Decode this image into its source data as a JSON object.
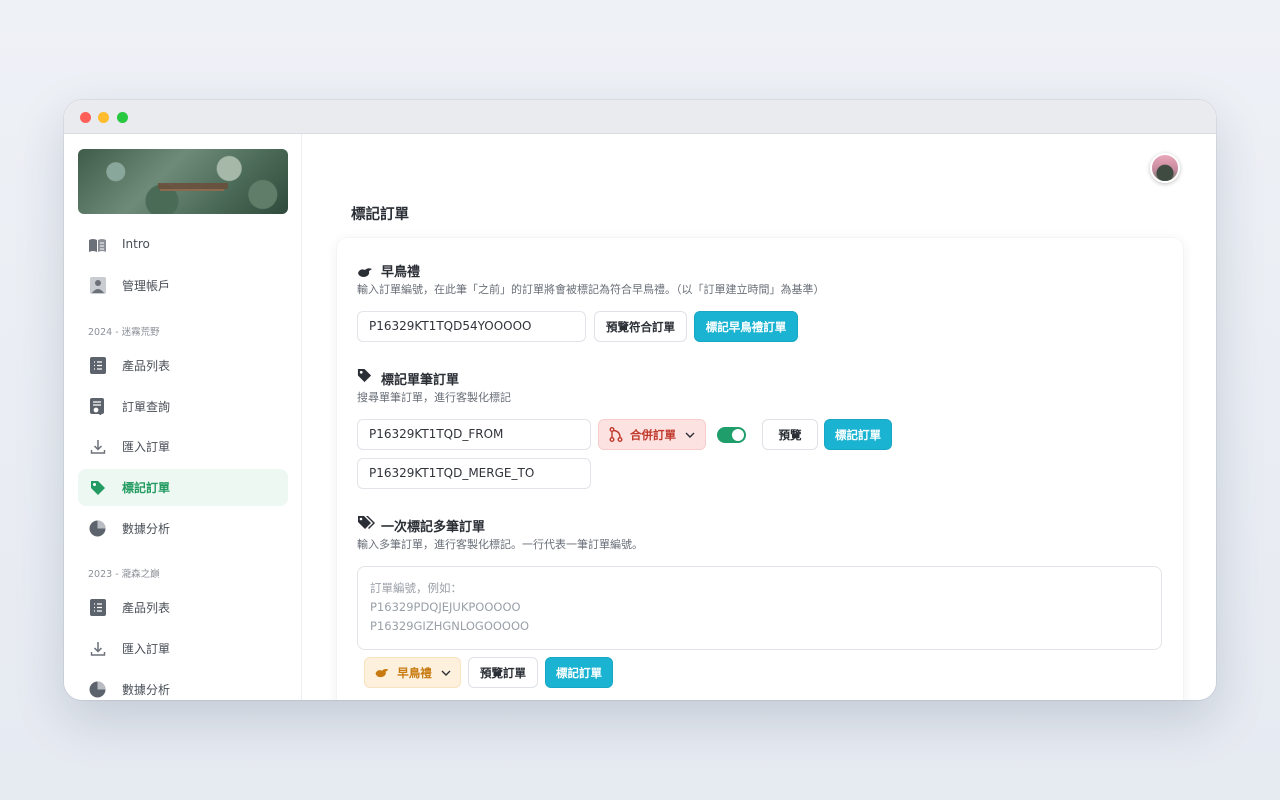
{
  "sidebar": {
    "items_top": [
      {
        "label": "Intro"
      },
      {
        "label": "管理帳戶"
      }
    ],
    "section_2024": "2024 - 迷霧荒野",
    "items_2024": [
      {
        "label": "產品列表"
      },
      {
        "label": "訂單查詢"
      },
      {
        "label": "匯入訂單"
      },
      {
        "label": "標記訂單"
      },
      {
        "label": "數據分析"
      }
    ],
    "section_2023": "2023 - 瀧森之巔",
    "items_2023": [
      {
        "label": "產品列表"
      },
      {
        "label": "匯入訂單"
      },
      {
        "label": "數據分析"
      }
    ]
  },
  "main": {
    "page_title": "標記訂單",
    "early_bird": {
      "title": "早鳥禮",
      "desc": "輸入訂單編號，在此筆「之前」的訂單將會被標記為符合早鳥禮。（以「訂單建立時間」為基準）",
      "input_value": "P16329KT1TQD54YOOOOO",
      "preview_label": "預覽符合訂單",
      "mark_label": "標記早鳥禮訂單"
    },
    "single": {
      "title": "標記單筆訂單",
      "desc": "搜尋單筆訂單，進行客製化標記",
      "from_value": "P16329KT1TQD_FROM",
      "merge_to_value": "P16329KT1TQD_MERGE_TO",
      "dropdown_label": "合併訂單",
      "toggle_on": true,
      "preview_label": "預覽",
      "mark_label": "標記訂單"
    },
    "multi": {
      "title": "一次標記多筆訂單",
      "desc": "輸入多筆訂單，進行客製化標記。一行代表一筆訂單編號。",
      "placeholder": "訂單編號，例如：\nP16329PDQJEJUKPOOOOO\nP16329GIZHGNLOGOOOOO",
      "dropdown_label": "早鳥禮",
      "preview_label": "預覽訂單",
      "mark_label": "標記訂單"
    }
  },
  "colors": {
    "primary": "#1bb3d2",
    "active_green": "#239b62",
    "danger": "#c0392b",
    "warn": "#c77a0f"
  }
}
